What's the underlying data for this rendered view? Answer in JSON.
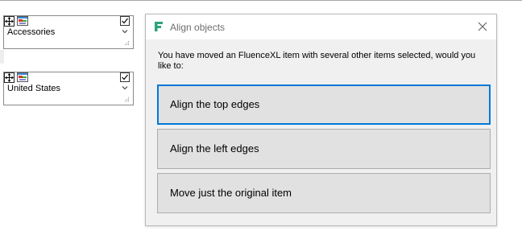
{
  "controls": [
    {
      "value": "Accessories"
    },
    {
      "value": "United States"
    }
  ],
  "dialog": {
    "title": "Align objects",
    "message": "You have moved an FluenceXL item with several other items selected, would you like to:",
    "options": [
      {
        "label": "Align the top edges",
        "focused": true
      },
      {
        "label": "Align the left edges",
        "focused": false
      },
      {
        "label": "Move just the original item",
        "focused": false
      }
    ]
  },
  "colors": {
    "accent": "#0078d7",
    "logo": "#2ea37a"
  },
  "icons": [
    "move-icon",
    "image-icon",
    "checkbox-icon",
    "chevron-down-icon",
    "resize-grip-icon",
    "fluencexl-logo-icon",
    "close-icon"
  ]
}
